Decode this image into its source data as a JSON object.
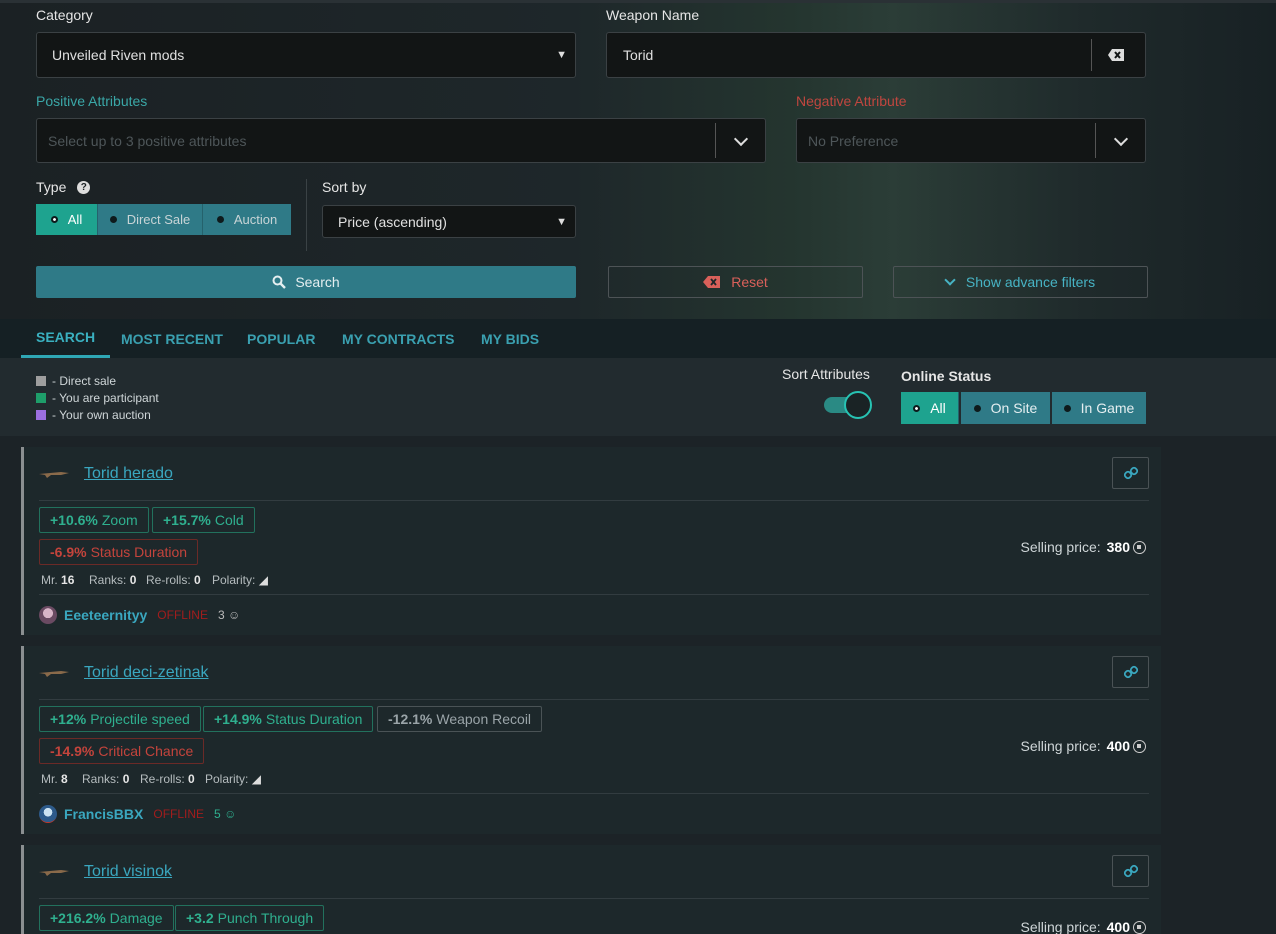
{
  "filters": {
    "category_label": "Category",
    "category_value": "Unveiled Riven mods",
    "weapon_label": "Weapon Name",
    "weapon_value": "Torid",
    "positive_label": "Positive Attributes",
    "positive_placeholder": "Select up to 3 positive attributes",
    "negative_label": "Negative Attribute",
    "negative_placeholder": "No Preference",
    "type_label": "Type",
    "type_options": [
      "All",
      "Direct Sale",
      "Auction"
    ],
    "sortby_label": "Sort by",
    "sortby_value": "Price (ascending)",
    "search_label": "Search",
    "reset_label": "Reset",
    "advance_label": "Show advance filters"
  },
  "tabs": [
    "SEARCH",
    "MOST RECENT",
    "POPULAR",
    "MY CONTRACTS",
    "MY BIDS"
  ],
  "legend": [
    {
      "text": "- Direct sale",
      "color": "#9e9e9e"
    },
    {
      "text": "- You are participant",
      "color": "#1e9e6a"
    },
    {
      "text": "- Your own auction",
      "color": "#9c6fe0"
    }
  ],
  "sort_attributes_label": "Sort Attributes",
  "online_status": {
    "label": "Online Status",
    "options": [
      "All",
      "On Site",
      "In Game"
    ]
  },
  "listings": [
    {
      "title": "Torid herado",
      "attributes": [
        {
          "value": "+10.6%",
          "name": "Zoom",
          "kind": "pos"
        },
        {
          "value": "+15.7%",
          "name": "Cold",
          "kind": "pos"
        },
        {
          "value": "-6.9%",
          "name": "Status Duration",
          "kind": "neg"
        }
      ],
      "mr_label": "Mr.",
      "mr": "16",
      "ranks_label": "Ranks:",
      "ranks": "0",
      "rerolls_label": "Re-rolls:",
      "rerolls": "0",
      "polarity_label": "Polarity:",
      "seller": "Eeeteernityy",
      "status": "OFFLINE",
      "rep": "3",
      "price_label": "Selling price:",
      "price": "380"
    },
    {
      "title": "Torid deci-zetinak",
      "attributes": [
        {
          "value": "+12%",
          "name": "Projectile speed",
          "kind": "pos"
        },
        {
          "value": "+14.9%",
          "name": "Status Duration",
          "kind": "pos"
        },
        {
          "value": "-12.1%",
          "name": "Weapon Recoil",
          "kind": "neu"
        },
        {
          "value": "-14.9%",
          "name": "Critical Chance",
          "kind": "neg"
        }
      ],
      "mr_label": "Mr.",
      "mr": "8",
      "ranks_label": "Ranks:",
      "ranks": "0",
      "rerolls_label": "Re-rolls:",
      "rerolls": "0",
      "polarity_label": "Polarity:",
      "seller": "FrancisBBX",
      "status": "OFFLINE",
      "rep": "5",
      "price_label": "Selling price:",
      "price": "400"
    },
    {
      "title": "Torid visinok",
      "attributes": [
        {
          "value": "+216.2%",
          "name": "Damage",
          "kind": "pos"
        },
        {
          "value": "+3.2",
          "name": "Punch Through",
          "kind": "pos"
        }
      ],
      "price_label": "Selling price:",
      "price": "400"
    }
  ]
}
